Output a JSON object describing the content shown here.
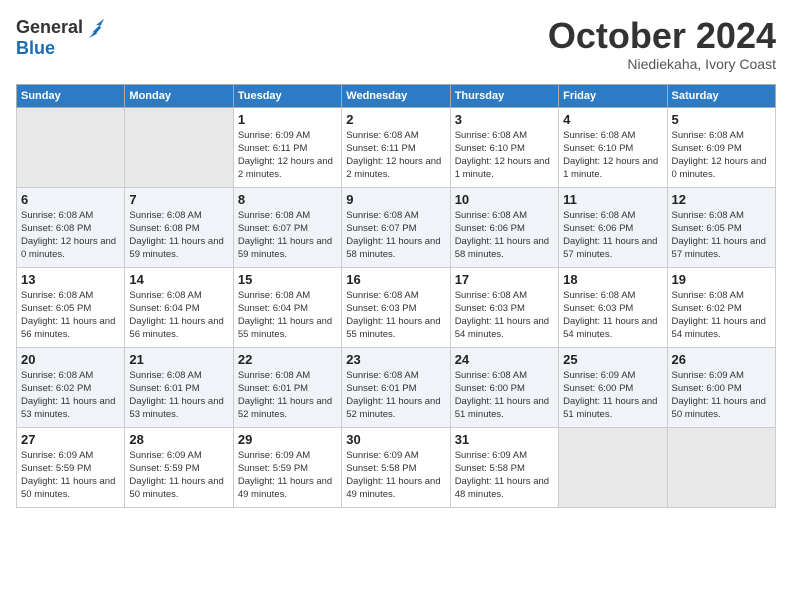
{
  "header": {
    "logo_general": "General",
    "logo_blue": "Blue",
    "month": "October 2024",
    "location": "Niediekaha, Ivory Coast"
  },
  "weekdays": [
    "Sunday",
    "Monday",
    "Tuesday",
    "Wednesday",
    "Thursday",
    "Friday",
    "Saturday"
  ],
  "weeks": [
    [
      {
        "day": "",
        "empty": true
      },
      {
        "day": "",
        "empty": true
      },
      {
        "day": "1",
        "sunrise": "6:09 AM",
        "sunset": "6:11 PM",
        "daylight": "12 hours and 2 minutes."
      },
      {
        "day": "2",
        "sunrise": "6:08 AM",
        "sunset": "6:11 PM",
        "daylight": "12 hours and 2 minutes."
      },
      {
        "day": "3",
        "sunrise": "6:08 AM",
        "sunset": "6:10 PM",
        "daylight": "12 hours and 1 minute."
      },
      {
        "day": "4",
        "sunrise": "6:08 AM",
        "sunset": "6:10 PM",
        "daylight": "12 hours and 1 minute."
      },
      {
        "day": "5",
        "sunrise": "6:08 AM",
        "sunset": "6:09 PM",
        "daylight": "12 hours and 0 minutes."
      }
    ],
    [
      {
        "day": "6",
        "sunrise": "6:08 AM",
        "sunset": "6:08 PM",
        "daylight": "12 hours and 0 minutes."
      },
      {
        "day": "7",
        "sunrise": "6:08 AM",
        "sunset": "6:08 PM",
        "daylight": "11 hours and 59 minutes."
      },
      {
        "day": "8",
        "sunrise": "6:08 AM",
        "sunset": "6:07 PM",
        "daylight": "11 hours and 59 minutes."
      },
      {
        "day": "9",
        "sunrise": "6:08 AM",
        "sunset": "6:07 PM",
        "daylight": "11 hours and 58 minutes."
      },
      {
        "day": "10",
        "sunrise": "6:08 AM",
        "sunset": "6:06 PM",
        "daylight": "11 hours and 58 minutes."
      },
      {
        "day": "11",
        "sunrise": "6:08 AM",
        "sunset": "6:06 PM",
        "daylight": "11 hours and 57 minutes."
      },
      {
        "day": "12",
        "sunrise": "6:08 AM",
        "sunset": "6:05 PM",
        "daylight": "11 hours and 57 minutes."
      }
    ],
    [
      {
        "day": "13",
        "sunrise": "6:08 AM",
        "sunset": "6:05 PM",
        "daylight": "11 hours and 56 minutes."
      },
      {
        "day": "14",
        "sunrise": "6:08 AM",
        "sunset": "6:04 PM",
        "daylight": "11 hours and 56 minutes."
      },
      {
        "day": "15",
        "sunrise": "6:08 AM",
        "sunset": "6:04 PM",
        "daylight": "11 hours and 55 minutes."
      },
      {
        "day": "16",
        "sunrise": "6:08 AM",
        "sunset": "6:03 PM",
        "daylight": "11 hours and 55 minutes."
      },
      {
        "day": "17",
        "sunrise": "6:08 AM",
        "sunset": "6:03 PM",
        "daylight": "11 hours and 54 minutes."
      },
      {
        "day": "18",
        "sunrise": "6:08 AM",
        "sunset": "6:03 PM",
        "daylight": "11 hours and 54 minutes."
      },
      {
        "day": "19",
        "sunrise": "6:08 AM",
        "sunset": "6:02 PM",
        "daylight": "11 hours and 54 minutes."
      }
    ],
    [
      {
        "day": "20",
        "sunrise": "6:08 AM",
        "sunset": "6:02 PM",
        "daylight": "11 hours and 53 minutes."
      },
      {
        "day": "21",
        "sunrise": "6:08 AM",
        "sunset": "6:01 PM",
        "daylight": "11 hours and 53 minutes."
      },
      {
        "day": "22",
        "sunrise": "6:08 AM",
        "sunset": "6:01 PM",
        "daylight": "11 hours and 52 minutes."
      },
      {
        "day": "23",
        "sunrise": "6:08 AM",
        "sunset": "6:01 PM",
        "daylight": "11 hours and 52 minutes."
      },
      {
        "day": "24",
        "sunrise": "6:08 AM",
        "sunset": "6:00 PM",
        "daylight": "11 hours and 51 minutes."
      },
      {
        "day": "25",
        "sunrise": "6:09 AM",
        "sunset": "6:00 PM",
        "daylight": "11 hours and 51 minutes."
      },
      {
        "day": "26",
        "sunrise": "6:09 AM",
        "sunset": "6:00 PM",
        "daylight": "11 hours and 50 minutes."
      }
    ],
    [
      {
        "day": "27",
        "sunrise": "6:09 AM",
        "sunset": "5:59 PM",
        "daylight": "11 hours and 50 minutes."
      },
      {
        "day": "28",
        "sunrise": "6:09 AM",
        "sunset": "5:59 PM",
        "daylight": "11 hours and 50 minutes."
      },
      {
        "day": "29",
        "sunrise": "6:09 AM",
        "sunset": "5:59 PM",
        "daylight": "11 hours and 49 minutes."
      },
      {
        "day": "30",
        "sunrise": "6:09 AM",
        "sunset": "5:58 PM",
        "daylight": "11 hours and 49 minutes."
      },
      {
        "day": "31",
        "sunrise": "6:09 AM",
        "sunset": "5:58 PM",
        "daylight": "11 hours and 48 minutes."
      },
      {
        "day": "",
        "empty": true
      },
      {
        "day": "",
        "empty": true
      }
    ]
  ]
}
